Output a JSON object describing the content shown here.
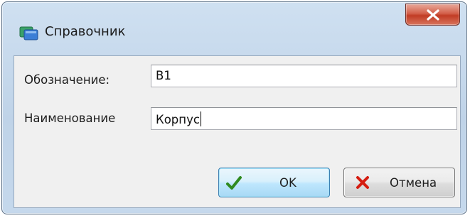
{
  "window": {
    "title": "Справочник",
    "close_icon": "close-icon"
  },
  "form": {
    "designation_label": "Обозначение:",
    "designation_value": "B1",
    "name_label": "Наименование",
    "name_value": "Корпус"
  },
  "buttons": {
    "ok_label": "OK",
    "ok_icon": "checkmark-icon",
    "cancel_label": "Отмена",
    "cancel_icon": "cross-icon"
  },
  "colors": {
    "frame": "#bfd3e8",
    "close_button": "#c13b24",
    "ok_check": "#2f8a1f",
    "cancel_cross": "#d51e12"
  }
}
